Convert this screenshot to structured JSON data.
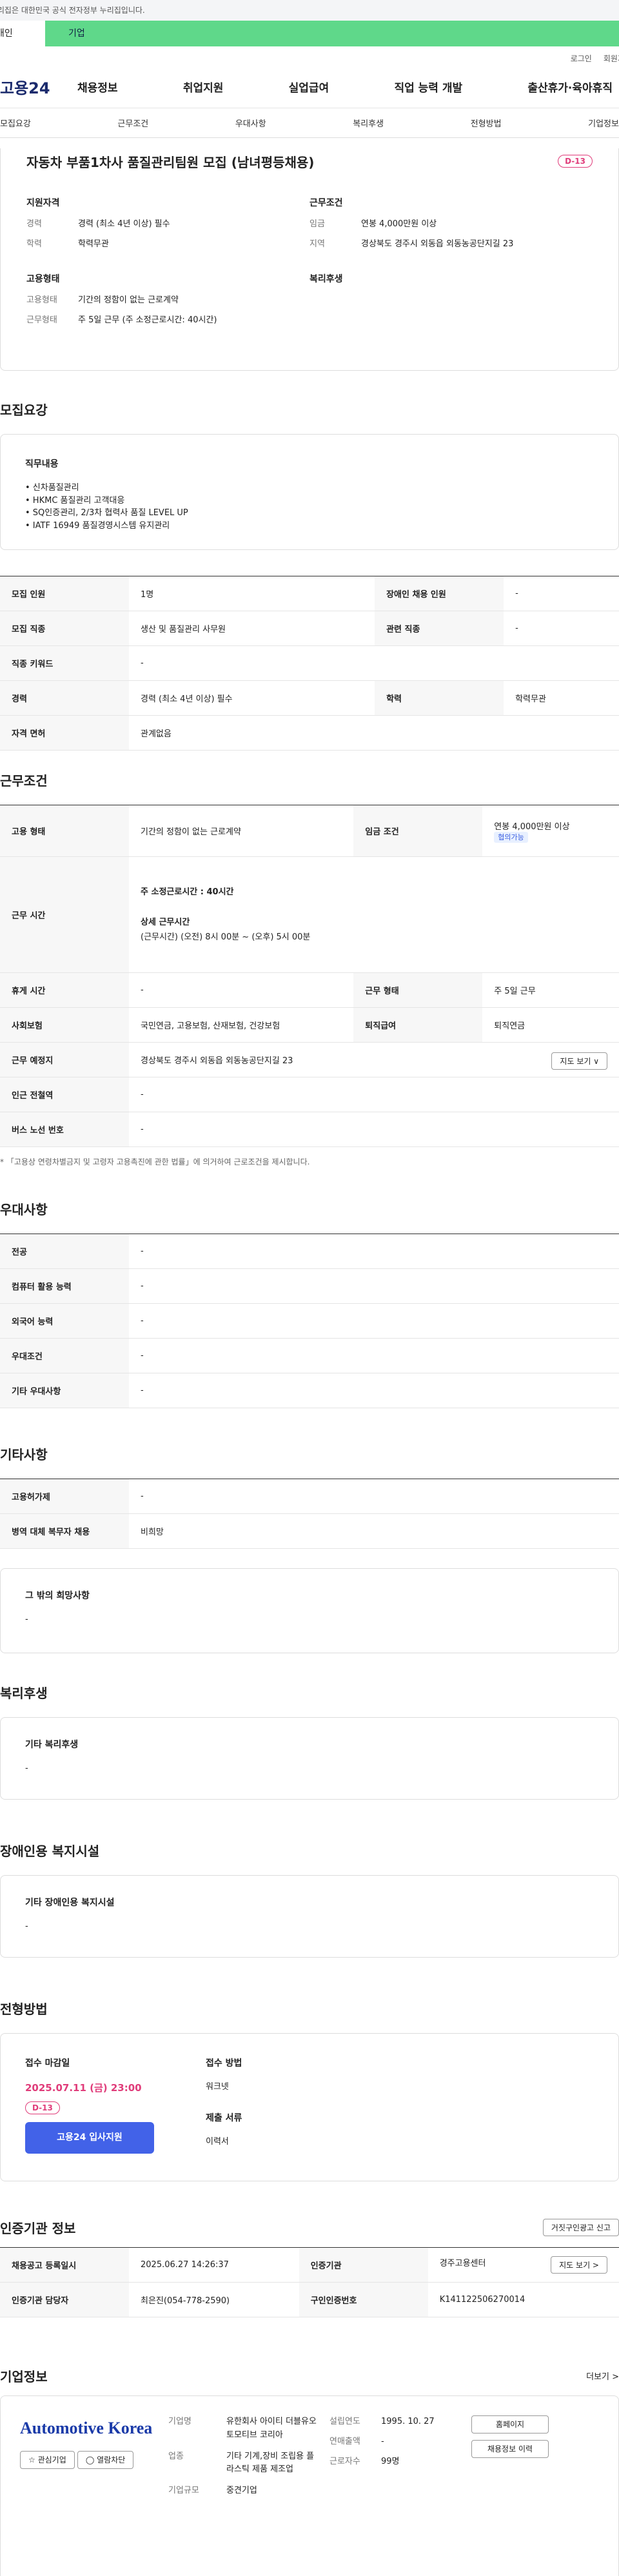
{
  "gov_notice": "이 누리집은 대한민국 공식 전자정부 누리집입니다.",
  "tabs": [
    "개인",
    "기업"
  ],
  "util": [
    "로그인",
    "회원가입"
  ],
  "logo": "고용24",
  "gnb": [
    "채용정보",
    "취업지원",
    "실업급여",
    "직업 능력 개발",
    "출산휴가·육아휴직"
  ],
  "subtabs": [
    "모집요강",
    "근무조건",
    "우대사항",
    "복리후생",
    "전형방법",
    "기업정보"
  ],
  "job": {
    "title": "자동차 부품1차사 품질관리팀원 모집 (남녀평등채용)",
    "dday": "D-13",
    "summary": {
      "qual_h": "지원자격",
      "career_k": "경력",
      "career_v": "경력 (최소 4년 이상) 필수",
      "edu_k": "학력",
      "edu_v": "학력무관",
      "work_h": "근무조건",
      "wage_k": "임금",
      "wage_v": "연봉 4,000만원 이상",
      "region_k": "지역",
      "region_v": "경상북도 경주시 외동읍 외동농공단지길 23",
      "emp_h": "고용형태",
      "emptype_k": "고용형태",
      "emptype_v": "기간의 정함이 없는 근로계약",
      "worktype_k": "근무형태",
      "worktype_v": "주 5일 근무 (주 소정근로시간: 40시간)",
      "welfare_h": "복리후생"
    }
  },
  "recruit": {
    "title": "모집요강",
    "duty_h": "직무내용",
    "duties": [
      "• 신차품질관리",
      "• HKMC 품질관리 고객대응",
      "• SQ인증관리, 2/3차 협력사 품질 LEVEL UP",
      "• IATF 16949 품질경영시스템 유지관리"
    ],
    "rows": [
      [
        "모집 인원",
        "1명",
        "장애인 채용 인원",
        "-"
      ],
      [
        "모집 직종",
        "생산 및 품질관리 사무원",
        "관련 직종",
        "-"
      ],
      [
        "직종 키워드",
        "-",
        "",
        ""
      ],
      [
        "경력",
        "경력 (최소 4년 이상) 필수",
        "학력",
        "학력무관"
      ],
      [
        "자격 면허",
        "관계없음",
        "",
        ""
      ]
    ]
  },
  "cond": {
    "title": "근무조건",
    "emp_k": "고용 형태",
    "emp_v": "기간의 정함이 없는 근로계약",
    "wage_k": "임금 조건",
    "wage_v": "연봉 4,000만원 이상",
    "wage_badge": "협의가능",
    "time_k": "근무 시간",
    "time_l1": "주 소정근로시간 : 40시간",
    "time_l2": "상세 근무시간",
    "time_l3": "(근무시간) (오전) 8시 00분 ~ (오후) 5시 00분",
    "rest_k": "휴게 시간",
    "rest_v": "-",
    "type_k": "근무 형태",
    "type_v": "주 5일 근무",
    "ins_k": "사회보험",
    "ins_v": "국민연금, 고용보험, 산재보험, 건강보험",
    "ret_k": "퇴직급여",
    "ret_v": "퇴직연금",
    "place_k": "근무 예정지",
    "place_v": "경상북도 경주시 외동읍 외동농공단지길 23",
    "map_btn": "지도 보기 ∨",
    "sub_k": "인근 전철역",
    "sub_v": "-",
    "bus_k": "버스 노선 번호",
    "bus_v": "-",
    "note": "* 「고용상 연령차별금지 및 고령자 고용촉진에 관한 법률」에 의거하여 근로조건을 제시합니다."
  },
  "pref": {
    "title": "우대사항",
    "rows": [
      [
        "전공",
        "-"
      ],
      [
        "컴퓨터 활용 능력",
        "-"
      ],
      [
        "외국어 능력",
        "-"
      ],
      [
        "우대조건",
        "-"
      ],
      [
        "기타 우대사항",
        "-"
      ]
    ]
  },
  "etc": {
    "title": "기타사항",
    "rows": [
      [
        "고용허가제",
        "-"
      ],
      [
        "병역 대체 복무자 채용",
        "비희망"
      ]
    ],
    "box_h": "그 밖의 희망사항",
    "box_v": "-"
  },
  "welfare": {
    "title": "복리후생",
    "box_h": "기타 복리후생",
    "box_v": "-"
  },
  "disabled": {
    "title": "장애인용 복지시설",
    "box_h": "기타 장애인용 복지시설",
    "box_v": "-"
  },
  "process": {
    "title": "전형방법",
    "deadline_h": "접수 마감일",
    "deadline_v": "2025.07.11 (금) 23:00",
    "dday": "D-13",
    "apply_btn": "고용24 입사지원",
    "method_h": "접수 방법",
    "method_v": "워크넷",
    "docs_h": "제출 서류",
    "docs_v": "이력서"
  },
  "cert": {
    "title": "인증기관 정보",
    "report_btn": "거짓구인광고 신고",
    "rows": [
      [
        "채용공고 등록일시",
        "2025.06.27 14:26:37",
        "인증기관",
        "경주고용센터"
      ],
      [
        "인증기관 담당자",
        "최은진(054-778-2590)",
        "구인인증번호",
        "K141122506270014"
      ]
    ],
    "map_btn": "지도 보기 >"
  },
  "company": {
    "title": "기업정보",
    "more": "더보기 >",
    "logo_text": "Automotive Korea",
    "fav_btn": "☆ 관심기업",
    "block_btn": "◯ 열람차단",
    "name_k": "기업명",
    "name_v": "유한회사 아이티 더블유오토모티브 코리아",
    "ind_k": "업종",
    "ind_v": "기타 기계,장비 조립용 플라스틱 제품 제조업",
    "size_k": "기업규모",
    "size_v": "중견기업",
    "year_k": "설립연도",
    "year_v": "1995. 10. 27",
    "sales_k": "연매출액",
    "sales_v": "-",
    "emp_k": "근로자수",
    "emp_v": "99명",
    "home_btn": "홈페이지",
    "hist_btn": "채용정보 이력"
  }
}
